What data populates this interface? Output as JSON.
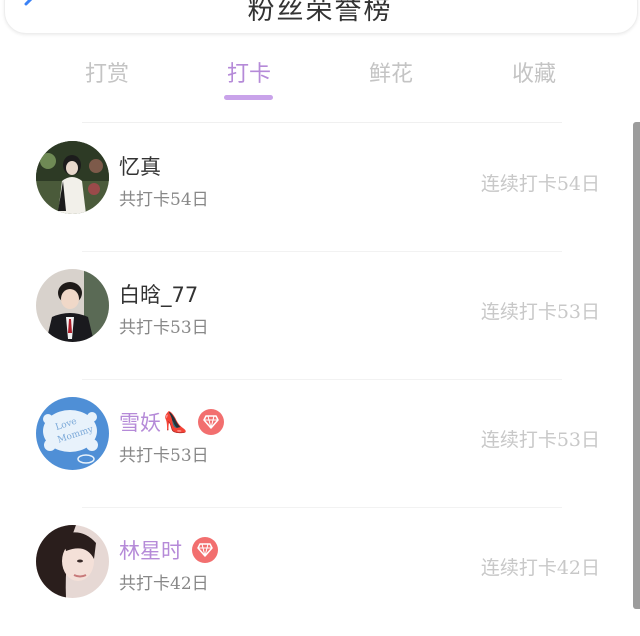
{
  "header": {
    "title": "粉丝荣誉榜"
  },
  "tabs": [
    {
      "label": "打赏"
    },
    {
      "label": "打卡"
    },
    {
      "label": "鲜花"
    },
    {
      "label": "收藏"
    }
  ],
  "active_tab": "打卡",
  "colors": {
    "accent": "#b58ad8",
    "badge": "#f26f6f"
  },
  "rows": [
    {
      "name": "忆真",
      "total": "共打卡54日",
      "streak": "连续打卡54日",
      "vip": false
    },
    {
      "name": "白晗_77",
      "total": "共打卡53日",
      "streak": "连续打卡53日",
      "vip": false
    },
    {
      "name": "雪妖",
      "total": "共打卡53日",
      "streak": "连续打卡53日",
      "vip": true,
      "emoji": "👠"
    },
    {
      "name": "林星时",
      "total": "共打卡42日",
      "streak": "连续打卡42日",
      "vip": true
    }
  ]
}
